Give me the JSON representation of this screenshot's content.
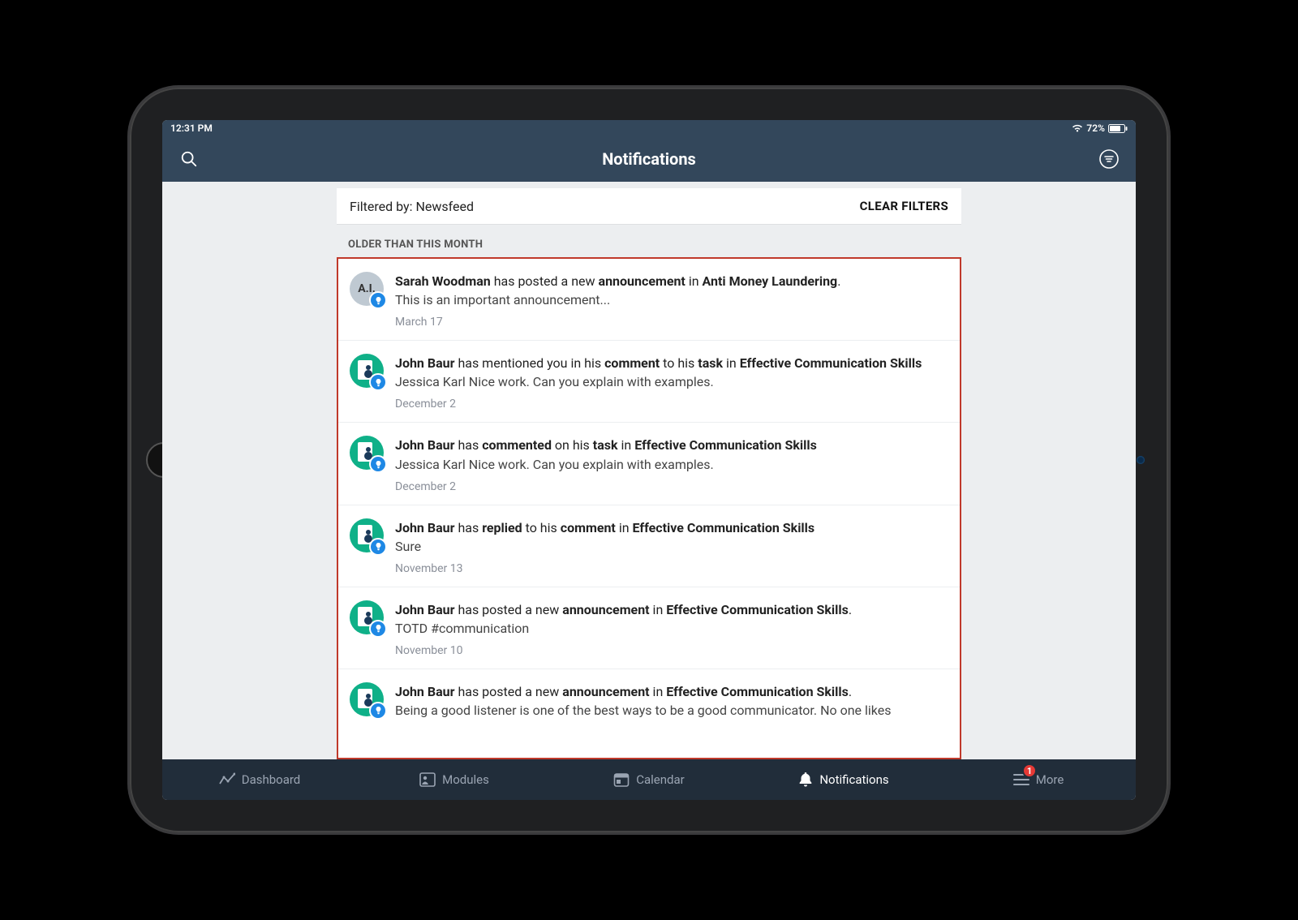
{
  "status": {
    "time": "12:31 PM",
    "battery_pct": "72%"
  },
  "header": {
    "title": "Notifications"
  },
  "filter": {
    "prefix": "Filtered by:",
    "value": "Newsfeed",
    "clear": "CLEAR FILTERS"
  },
  "section": {
    "older": "OLDER THAN THIS MONTH"
  },
  "notifications": [
    {
      "avatar_type": "gray",
      "avatar_text": "A.I.",
      "segments": [
        {
          "t": "Sarah Woodman",
          "b": true
        },
        {
          "t": " has posted a new ",
          "b": false
        },
        {
          "t": "announcement",
          "b": true
        },
        {
          "t": " in ",
          "b": false
        },
        {
          "t": "Anti Money Laundering",
          "b": true
        },
        {
          "t": ".",
          "b": false
        }
      ],
      "preview": "This is an important announcement...",
      "date": "March 17"
    },
    {
      "avatar_type": "green",
      "segments": [
        {
          "t": "John Baur",
          "b": true
        },
        {
          "t": " has mentioned you in his ",
          "b": false
        },
        {
          "t": "comment",
          "b": true
        },
        {
          "t": " to his ",
          "b": false
        },
        {
          "t": "task",
          "b": true
        },
        {
          "t": " in ",
          "b": false
        },
        {
          "t": "Effective Communication Skills",
          "b": true
        }
      ],
      "preview": "Jessica Karl Nice work. Can you explain with examples.",
      "date": "December 2"
    },
    {
      "avatar_type": "green",
      "segments": [
        {
          "t": "John Baur",
          "b": true
        },
        {
          "t": " has ",
          "b": false
        },
        {
          "t": "commented",
          "b": true
        },
        {
          "t": " on his ",
          "b": false
        },
        {
          "t": "task",
          "b": true
        },
        {
          "t": " in ",
          "b": false
        },
        {
          "t": "Effective Communication Skills",
          "b": true
        }
      ],
      "preview": "Jessica Karl Nice work. Can you explain with examples.",
      "date": "December 2"
    },
    {
      "avatar_type": "green",
      "segments": [
        {
          "t": "John Baur",
          "b": true
        },
        {
          "t": " has ",
          "b": false
        },
        {
          "t": "replied",
          "b": true
        },
        {
          "t": " to his ",
          "b": false
        },
        {
          "t": "comment",
          "b": true
        },
        {
          "t": " in ",
          "b": false
        },
        {
          "t": "Effective Communication Skills",
          "b": true
        }
      ],
      "preview": "Sure",
      "date": "November 13"
    },
    {
      "avatar_type": "green",
      "segments": [
        {
          "t": "John Baur",
          "b": true
        },
        {
          "t": " has posted a new ",
          "b": false
        },
        {
          "t": "announcement",
          "b": true
        },
        {
          "t": " in ",
          "b": false
        },
        {
          "t": "Effective Communication Skills",
          "b": true
        },
        {
          "t": ".",
          "b": false
        }
      ],
      "preview": "TOTD  #communication",
      "date": "November 10"
    },
    {
      "avatar_type": "green",
      "segments": [
        {
          "t": "John Baur",
          "b": true
        },
        {
          "t": " has posted a new ",
          "b": false
        },
        {
          "t": "announcement",
          "b": true
        },
        {
          "t": " in ",
          "b": false
        },
        {
          "t": "Effective Communication Skills",
          "b": true
        },
        {
          "t": ".",
          "b": false
        }
      ],
      "preview": "Being a good listener is one of the best ways to be a good communicator. No one likes",
      "date": ""
    }
  ],
  "tabs": {
    "dashboard": "Dashboard",
    "modules": "Modules",
    "calendar": "Calendar",
    "notifications": "Notifications",
    "more": "More",
    "more_badge": "1"
  }
}
